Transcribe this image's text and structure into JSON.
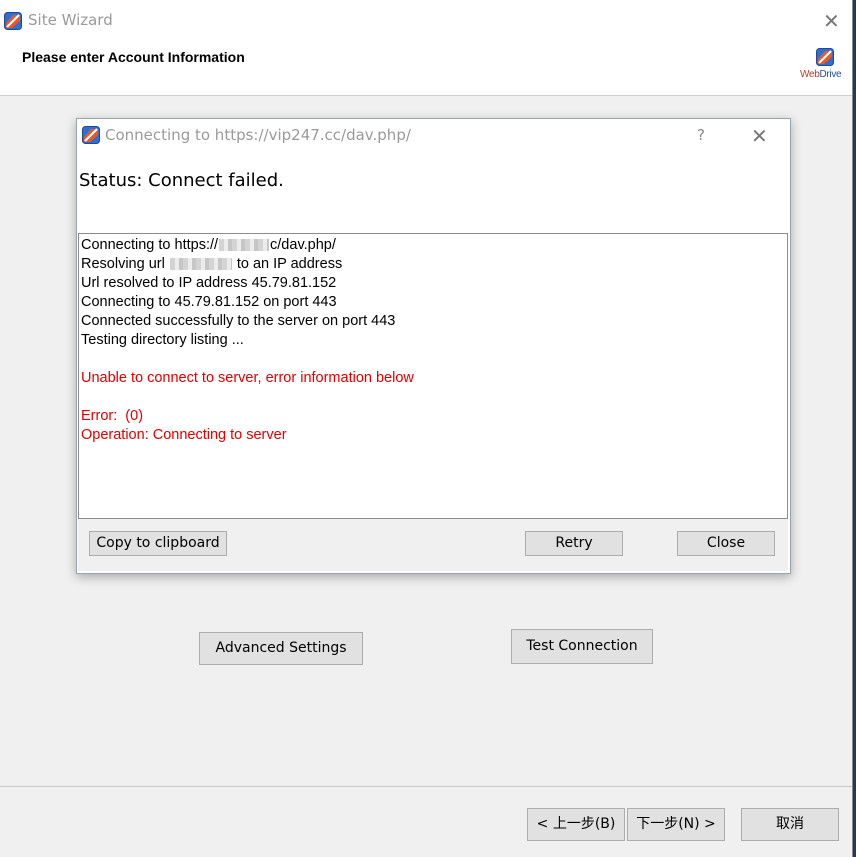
{
  "wizard": {
    "title": "Site Wizard",
    "header_title": "Please enter Account Information",
    "logo_text_a": "Web",
    "logo_text_b": "Drive",
    "advanced_settings": "Advanced Settings",
    "test_connection": "Test Connection",
    "back": "< 上一步(B)",
    "next": "下一步(N) >",
    "cancel": "取消",
    "close_glyph": "✕"
  },
  "dialog": {
    "title": "Connecting to https://vip247.cc/dav.php/",
    "help": "?",
    "close_glyph": "✕",
    "status": "Status: Connect failed.",
    "log": {
      "l1a": "Connecting to https://",
      "l1b": "c/dav.php/",
      "l2a": "Resolving url ",
      "l2b": " to an IP address",
      "l3": "Url resolved to IP address 45.79.81.152",
      "l4": "Connecting to 45.79.81.152 on port 443",
      "l5": "Connected successfully to the server on port 443",
      "l6": "Testing directory listing ...",
      "l7": "Unable to connect to server, error information below",
      "l8": "Error:  (0)",
      "l9": "Operation: Connecting to server"
    },
    "copy": "Copy to clipboard",
    "retry": "Retry",
    "close": "Close"
  },
  "colors": {
    "error_text": "#e00000",
    "logo_red": "#c0392b",
    "logo_blue": "#1e4fa0"
  },
  "icons": [
    "webdrive-app-icon",
    "close-icon",
    "help-icon",
    "webdrive-logo"
  ]
}
